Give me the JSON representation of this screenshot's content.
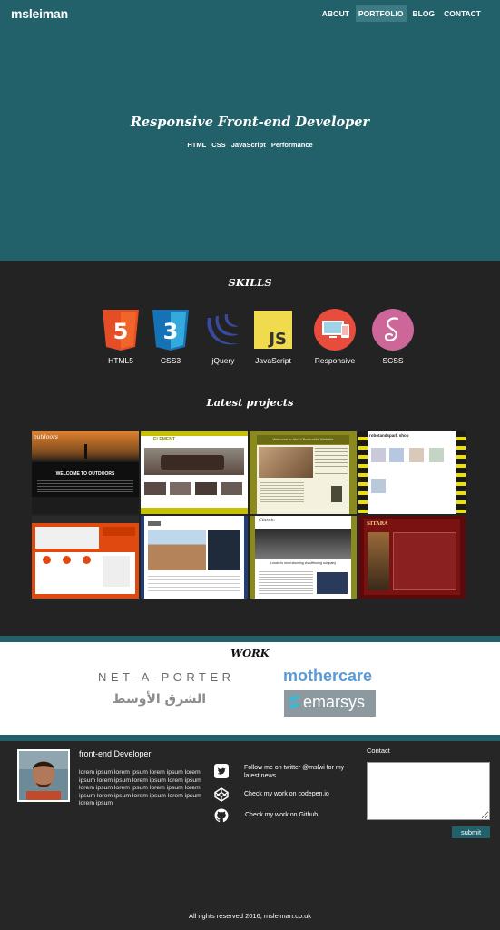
{
  "header": {
    "logo": "msleiman",
    "nav": [
      {
        "label": "ABOUT",
        "active": false
      },
      {
        "label": "PORTFOLIO",
        "active": true
      },
      {
        "label": "BLOG",
        "active": false
      },
      {
        "label": "CONTACT",
        "active": false
      }
    ]
  },
  "hero": {
    "title": "Responsive Front-end Developer",
    "skills": [
      "HTML",
      "CSS",
      "JavaScript",
      "Performance"
    ]
  },
  "skills": {
    "title": "SKILLS",
    "items": [
      {
        "label": "HTML5",
        "icon": "html5-icon",
        "color": "#e44d26"
      },
      {
        "label": "CSS3",
        "icon": "css3-icon",
        "color": "#1572b6"
      },
      {
        "label": "jQuery",
        "icon": "jquery-icon",
        "color": "#3a4a9e"
      },
      {
        "label": "JavaScript",
        "icon": "javascript-icon",
        "color": "#f0db4f"
      },
      {
        "label": "Responsive",
        "icon": "responsive-icon",
        "color": "#e84c3d"
      },
      {
        "label": "SCSS",
        "icon": "sass-icon",
        "color": "#cd6799"
      }
    ]
  },
  "projects": {
    "title": "Latest projects",
    "items": [
      {
        "name": "outdoors",
        "heading": "outdoors",
        "subtitle": "WELCOME TO OUTDOORS"
      },
      {
        "name": "furniture",
        "heading": "ELEMENT"
      },
      {
        "name": "abdul-badruddin",
        "heading": "Welcome to Abdul Badruddin Website"
      },
      {
        "name": "robotandspark",
        "heading": "robotandspark shop"
      },
      {
        "name": "orange-site",
        "heading": "",
        "subtitle": ""
      },
      {
        "name": "apartments",
        "heading": ""
      },
      {
        "name": "chauffeurs",
        "heading": "Classic",
        "subtitle": "London's most stunning chauffeuring company"
      },
      {
        "name": "sitara",
        "heading": "SITARA"
      }
    ]
  },
  "work": {
    "title": "WORK",
    "brands": {
      "netaporter": "NET-A-PORTER",
      "mothercare": "mothercare",
      "asharq": "الشرق الأوسط",
      "emarsys": "emarsys"
    }
  },
  "footer": {
    "role": "front-end Developer",
    "bio": "lorem ipsum lorem ipsum lorem ipsum lorem ipsum lorem ipsum lorem ipsum lorem ipsum lorem ipsum lorem ipsum lorem ipsum lorem ipsum lorem ipsum lorem ipsum lorem ipsum lorem ipsum",
    "social": [
      {
        "icon": "twitter-icon",
        "text": "Follow me on twitter @mslwi  for my latest news"
      },
      {
        "icon": "codepen-icon",
        "text": "Check my work on codepen.io"
      },
      {
        "icon": "github-icon",
        "text": "Check my work on Github"
      }
    ],
    "contact_label": "Contact",
    "submit_label": "submit",
    "copyright": "All rights reserved  2016, msleiman.co.uk"
  }
}
